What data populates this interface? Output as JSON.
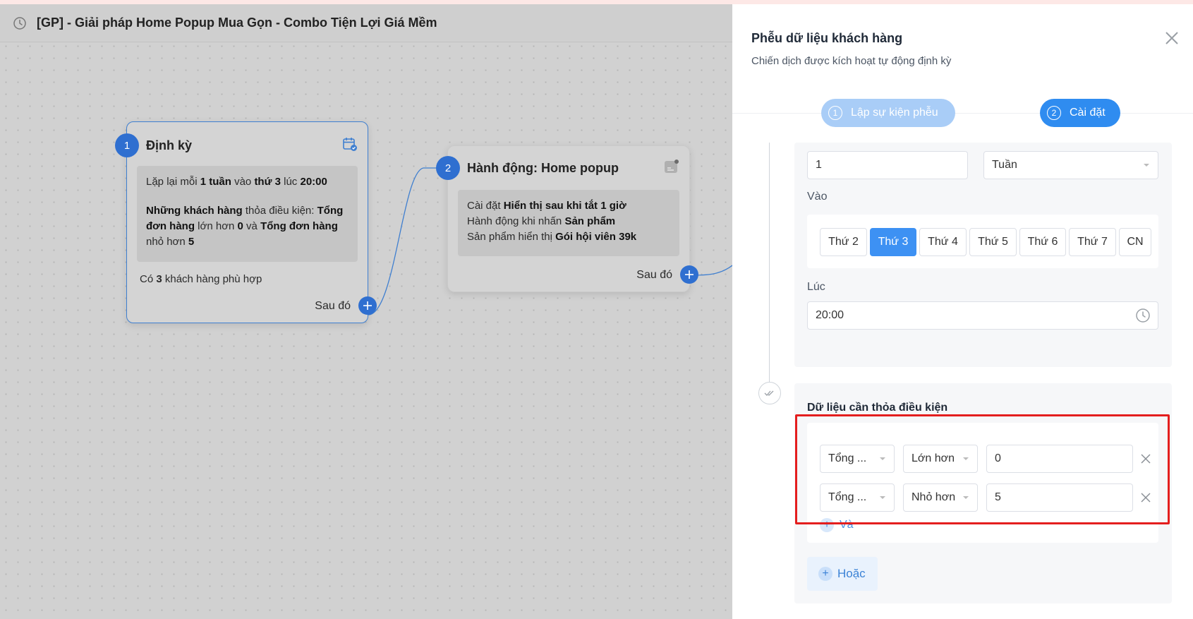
{
  "canvas": {
    "title": "[GP] - Giải pháp Home Popup Mua Gọn - Combo Tiện Lợi Giá Mềm",
    "nodes": [
      {
        "number": "1",
        "title": "Định kỳ",
        "icon": "calendar-check-icon",
        "detail": {
          "l1_a": "Lặp lại mỗi ",
          "l1_b": "1 tuần",
          "l1_c": " vào ",
          "l1_d": "thứ 3",
          "l1_e": " lúc ",
          "l1_f": "20:00",
          "l2_a": "Những khách hàng",
          "l2_b": " thỏa điều kiện: ",
          "l2_c": "Tổng",
          "l3_a": "đơn hàng",
          "l3_b": " lớn hơn ",
          "l3_c": "0",
          "l3_d": " và ",
          "l3_e": "Tổng đơn hàng",
          "l4_a": "nhỏ hơn ",
          "l4_b": "5"
        },
        "match_a": "Có ",
        "match_b": "3",
        "match_c": " khách hàng phù hợp",
        "then_label": "Sau đó"
      },
      {
        "number": "2",
        "title": "Hành động: Home popup",
        "icon": "popup-icon",
        "detail": {
          "l1_a": "Cài đặt ",
          "l1_b": "Hiển thị sau khi tắt 1 giờ",
          "l2_a": "Hành động khi nhấn ",
          "l2_b": "Sản phẩm",
          "l3_a": "Sản phẩm hiển thị ",
          "l3_b": "Gói hội viên 39k"
        },
        "then_label": "Sau đó"
      }
    ]
  },
  "panel": {
    "title": "Phễu dữ liệu khách hàng",
    "subtitle": "Chiến dịch được kích hoạt tự động định kỳ",
    "steps": [
      {
        "number": "1",
        "label": "Lập sự kiện phễu"
      },
      {
        "number": "2",
        "label": "Cài đặt"
      }
    ],
    "repeat_value": "1",
    "repeat_unit": "Tuần",
    "on_label": "Vào",
    "days": [
      "Thứ 2",
      "Thứ 3",
      "Thứ 4",
      "Thứ 5",
      "Thứ 6",
      "Thứ 7",
      "CN"
    ],
    "selected_day": "Thứ 3",
    "at_label": "Lúc",
    "time_value": "20:00",
    "conditions_title": "Dữ liệu cần thỏa điều kiện",
    "conditions": [
      {
        "field": "Tổng ...",
        "operator": "Lớn hơn",
        "value": "0"
      },
      {
        "field": "Tổng ...",
        "operator": "Nhỏ hơn",
        "value": "5"
      }
    ],
    "and_label": "Và",
    "or_label": "Hoặc"
  },
  "colors": {
    "accent": "#2f8cf0",
    "node_badge": "#2f6fd0",
    "highlight": "#e41e1e"
  }
}
